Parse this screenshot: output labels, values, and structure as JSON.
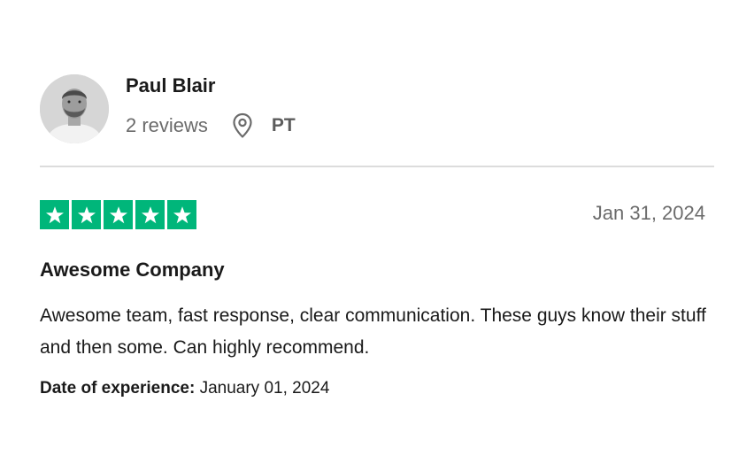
{
  "reviewer": {
    "name": "Paul Blair",
    "review_count": "2 reviews",
    "country": "PT"
  },
  "review": {
    "rating": 5,
    "max_rating": 5,
    "date": "Jan 31, 2024",
    "title": "Awesome Company",
    "body": "Awesome team, fast response, clear communication. These guys know their stuff and then some. Can highly recommend.",
    "experience_label": "Date of experience:",
    "experience_date": "January 01, 2024"
  },
  "icons": {
    "avatar": "avatar-photo",
    "location": "map-pin-icon",
    "star": "star-icon"
  },
  "colors": {
    "star_green": "#00b67a",
    "muted_text": "#6b6b6b",
    "divider": "#dcdcdc"
  }
}
